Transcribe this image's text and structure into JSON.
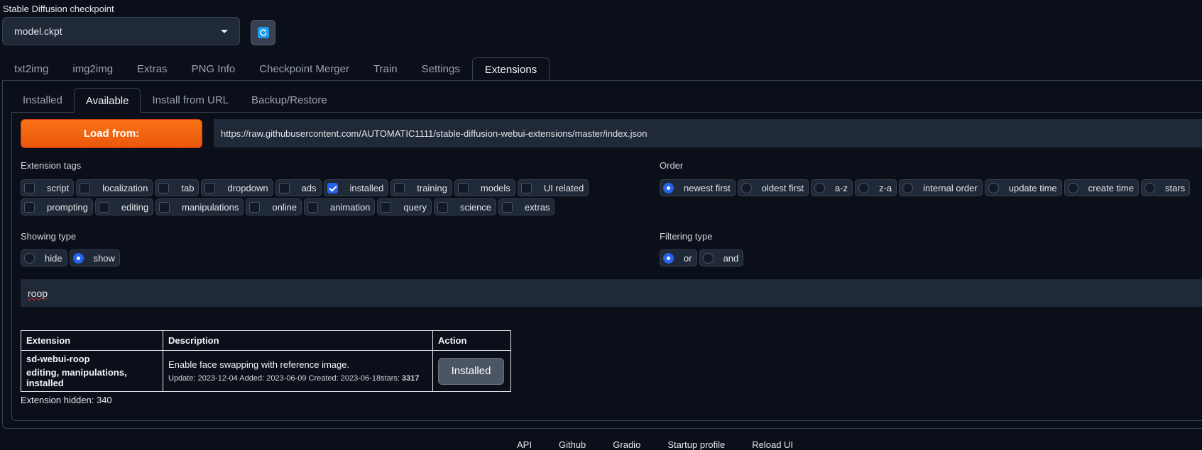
{
  "checkpoint": {
    "label": "Stable Diffusion checkpoint",
    "value": "model.ckpt"
  },
  "main_tabs": [
    {
      "label": "txt2img"
    },
    {
      "label": "img2img"
    },
    {
      "label": "Extras"
    },
    {
      "label": "PNG Info"
    },
    {
      "label": "Checkpoint Merger"
    },
    {
      "label": "Train"
    },
    {
      "label": "Settings"
    },
    {
      "label": "Extensions",
      "active": true
    }
  ],
  "sub_tabs": [
    {
      "label": "Installed"
    },
    {
      "label": "Available",
      "active": true
    },
    {
      "label": "Install from URL"
    },
    {
      "label": "Backup/Restore"
    }
  ],
  "load": {
    "button_label": "Load from:",
    "url": "https://raw.githubusercontent.com/AUTOMATIC1111/stable-diffusion-webui-extensions/master/index.json"
  },
  "extension_tags": {
    "label": "Extension tags",
    "items": [
      {
        "label": "script",
        "checked": false
      },
      {
        "label": "localization",
        "checked": false
      },
      {
        "label": "tab",
        "checked": false
      },
      {
        "label": "dropdown",
        "checked": false
      },
      {
        "label": "ads",
        "checked": false
      },
      {
        "label": "installed",
        "checked": true
      },
      {
        "label": "training",
        "checked": false
      },
      {
        "label": "models",
        "checked": false
      },
      {
        "label": "UI related",
        "checked": false
      },
      {
        "label": "prompting",
        "checked": false
      },
      {
        "label": "editing",
        "checked": false
      },
      {
        "label": "manipulations",
        "checked": false
      },
      {
        "label": "online",
        "checked": false
      },
      {
        "label": "animation",
        "checked": false
      },
      {
        "label": "query",
        "checked": false
      },
      {
        "label": "science",
        "checked": false
      },
      {
        "label": "extras",
        "checked": false
      }
    ]
  },
  "order": {
    "label": "Order",
    "items": [
      {
        "label": "newest first",
        "checked": true
      },
      {
        "label": "oldest first",
        "checked": false
      },
      {
        "label": "a-z",
        "checked": false
      },
      {
        "label": "z-a",
        "checked": false
      },
      {
        "label": "internal order",
        "checked": false
      },
      {
        "label": "update time",
        "checked": false
      },
      {
        "label": "create time",
        "checked": false
      },
      {
        "label": "stars",
        "checked": false
      }
    ]
  },
  "showing_type": {
    "label": "Showing type",
    "items": [
      {
        "label": "hide",
        "checked": false
      },
      {
        "label": "show",
        "checked": true
      }
    ]
  },
  "filtering_type": {
    "label": "Filtering type",
    "items": [
      {
        "label": "or",
        "checked": true
      },
      {
        "label": "and",
        "checked": false
      }
    ]
  },
  "search": {
    "value": "roop"
  },
  "table": {
    "headers": [
      "Extension",
      "Description",
      "Action"
    ],
    "rows": [
      {
        "name": "sd-webui-roop",
        "tags": "editing, manipulations, installed",
        "description": "Enable face swapping with reference image.",
        "meta_prefix": "Update: 2023-12-04 Added: 2023-06-09 Created: 2023-06-18stars: ",
        "stars": "3317",
        "action": "Installed"
      }
    ]
  },
  "hidden_text": "Extension hidden: 340",
  "footer": [
    {
      "label": "API"
    },
    {
      "label": "Github"
    },
    {
      "label": "Gradio"
    },
    {
      "label": "Startup profile"
    },
    {
      "label": "Reload UI"
    }
  ],
  "colors": {
    "accent": "#f97316",
    "checked": "#2563eb",
    "background": "#0b0f19"
  }
}
